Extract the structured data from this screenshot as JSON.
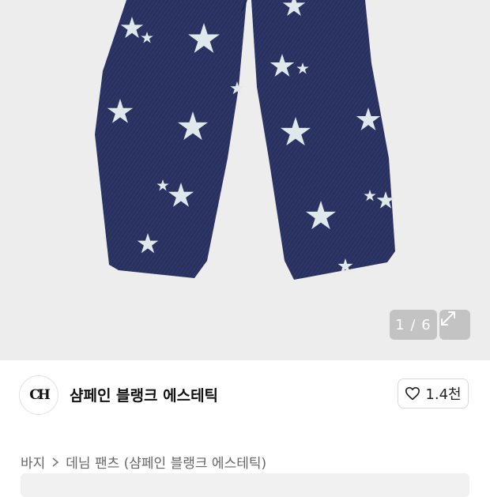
{
  "gallery": {
    "counter": "1 / 6",
    "expand_icon": "expand-arrows-icon"
  },
  "brand": {
    "logo_text": "CH",
    "name": "샴페인 블랭크 에스테틱",
    "like_icon": "heart-outline-icon",
    "like_count": "1.4천"
  },
  "breadcrumb": {
    "category": "바지",
    "separator_icon": "chevron-right-icon",
    "product": "데님 팬츠 (샴페인 블랭크 에스테틱)"
  },
  "colors": {
    "denim": "#28305f",
    "star": "#dfe9ec",
    "background": "#ededed"
  }
}
